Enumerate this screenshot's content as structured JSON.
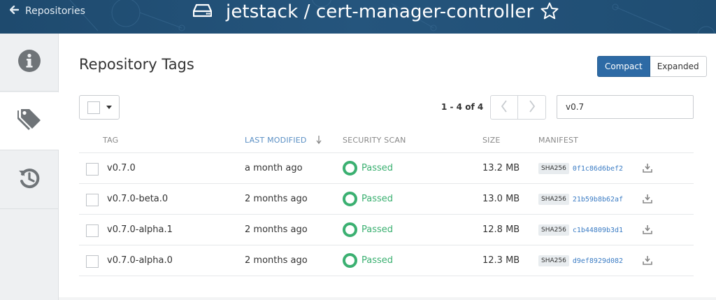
{
  "header": {
    "back_label": "Repositories",
    "title": "jetstack / cert-manager-controller",
    "icons": {
      "back": "arrow-left-icon",
      "repo": "hdd-icon",
      "star": "star-icon"
    }
  },
  "sidebar": {
    "items": [
      {
        "name": "info",
        "icon": "info-circle-icon",
        "active": false
      },
      {
        "name": "tags",
        "icon": "tags-icon",
        "active": true
      },
      {
        "name": "history",
        "icon": "history-icon",
        "active": false
      }
    ]
  },
  "main": {
    "title": "Repository Tags",
    "view_toggle": {
      "compact": "Compact",
      "expanded": "Expanded",
      "selected": "Compact"
    },
    "pagination": {
      "label": "1 - 4 of 4"
    },
    "filter": {
      "value": "v0.7"
    },
    "table": {
      "headers": {
        "tag": "TAG",
        "last_modified": "LAST MODIFIED",
        "security_scan": "SECURITY SCAN",
        "size": "SIZE",
        "manifest": "MANIFEST"
      },
      "rows": [
        {
          "tag": "v0.7.0",
          "last_modified": "a month ago",
          "scan": "Passed",
          "size": "13.2 MB",
          "sha": "SHA256",
          "digest": "0f1c86d6bef2"
        },
        {
          "tag": "v0.7.0-beta.0",
          "last_modified": "2 months ago",
          "scan": "Passed",
          "size": "13.0 MB",
          "sha": "SHA256",
          "digest": "21b59b8b62af"
        },
        {
          "tag": "v0.7.0-alpha.1",
          "last_modified": "2 months ago",
          "scan": "Passed",
          "size": "12.8 MB",
          "sha": "SHA256",
          "digest": "c1b44809b3d1"
        },
        {
          "tag": "v0.7.0-alpha.0",
          "last_modified": "2 months ago",
          "scan": "Passed",
          "size": "12.3 MB",
          "sha": "SHA256",
          "digest": "d9ef8929d082"
        }
      ]
    }
  },
  "colors": {
    "header_bg": "#25557d",
    "accent": "#2d6aa5",
    "passed": "#3bb071",
    "link": "#3b7cc4"
  }
}
